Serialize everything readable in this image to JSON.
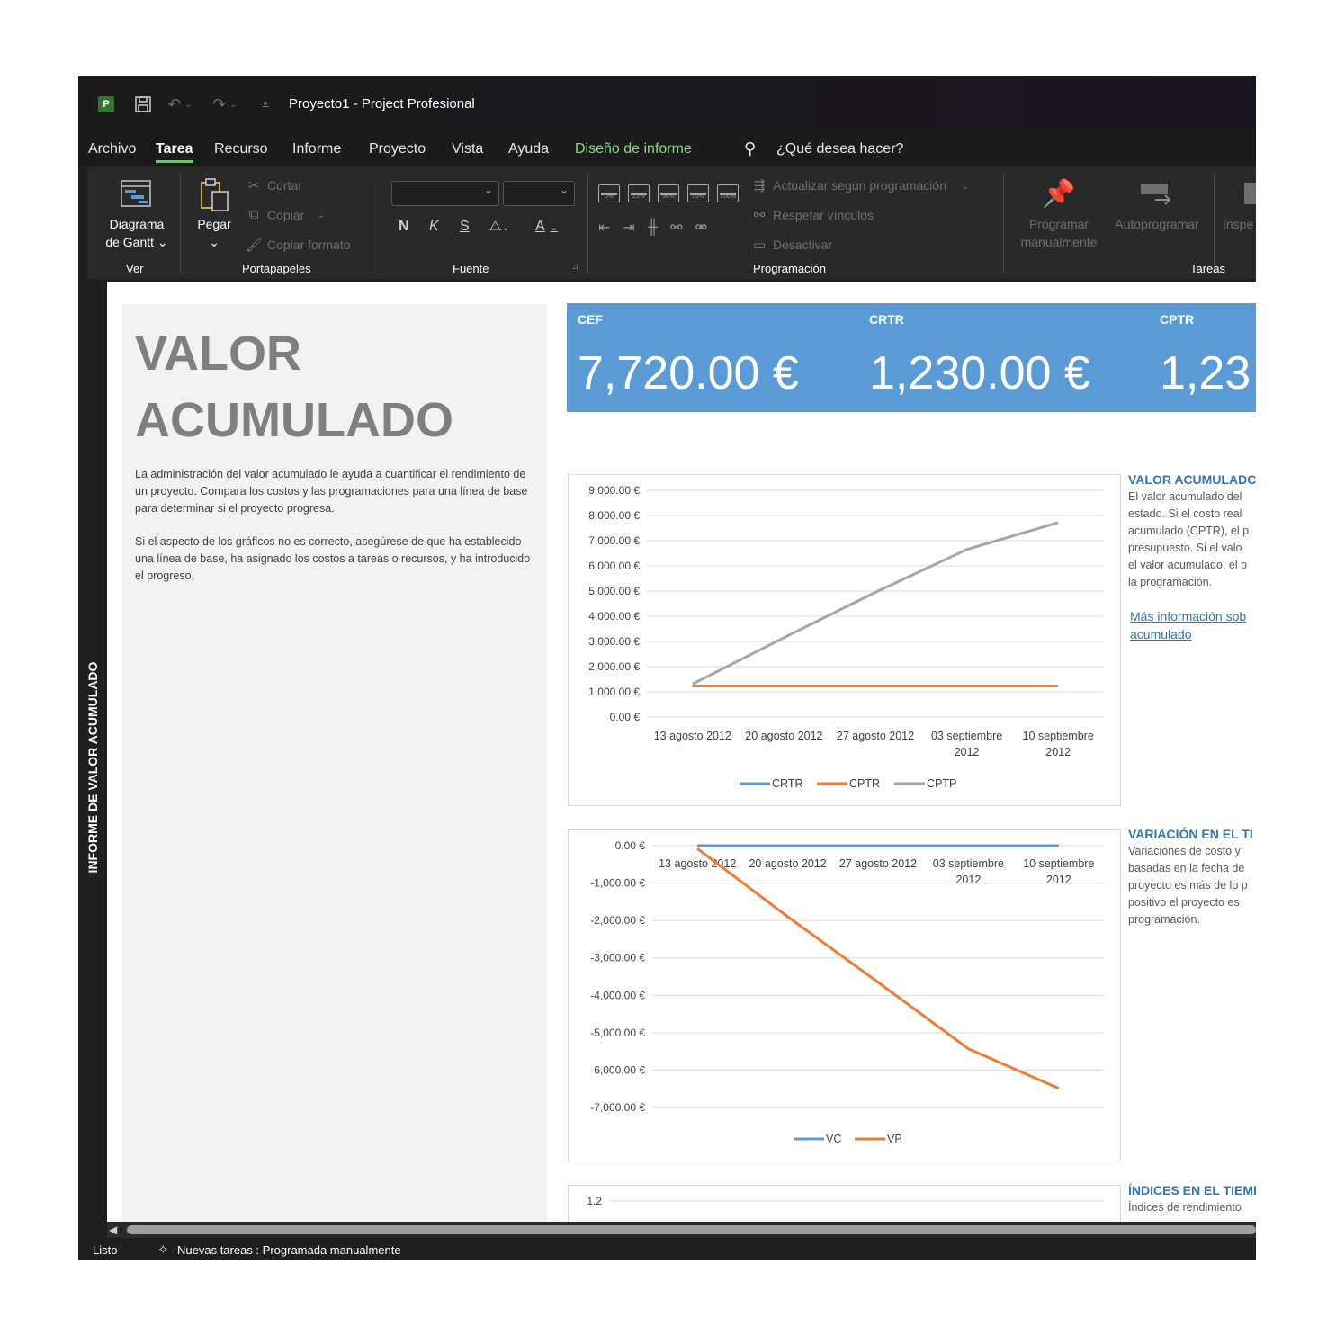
{
  "window": {
    "title": "Proyecto1  -  Project Profesional",
    "app_badge": "P"
  },
  "menu": {
    "tabs": [
      "Archivo",
      "Tarea",
      "Recurso",
      "Informe",
      "Proyecto",
      "Vista",
      "Ayuda",
      "Diseño de informe"
    ],
    "active": "Tarea",
    "search_placeholder": "¿Qué desea hacer?"
  },
  "ribbon": {
    "groups": {
      "ver": "Ver",
      "portapapeles": "Portapapeles",
      "fuente": "Fuente",
      "programacion": "Programación",
      "tareas": "Tareas"
    },
    "gantt": {
      "line1": "Diagrama",
      "line2": "de Gantt ⌄"
    },
    "paste": {
      "label": "Pegar",
      "arrow": "⌄"
    },
    "clipboard": {
      "cut": "Cortar",
      "copy": "Copiar",
      "copy_arrow": "⌄",
      "format_painter": "Copiar formato"
    },
    "font": {
      "bold": "N",
      "italic": "K",
      "underline": "S"
    },
    "percent_buttons": [
      "0%",
      "25%",
      "50%",
      "75%",
      "100%"
    ],
    "scheduling": {
      "update": "Actualizar según programación",
      "update_arrow": "⌄",
      "respect_links": "Respetar vínculos",
      "deactivate": "Desactivar"
    },
    "tasks": {
      "manual_line1": "Programar",
      "manual_line2": "manualmente",
      "auto": "Autoprogramar",
      "inspect": "Inspe"
    }
  },
  "side_label": "INFORME DE VALOR ACUMULADO",
  "report": {
    "title_line1": "VALOR",
    "title_line2": "ACUMULADO",
    "paragraph1": "La administración del valor acumulado le ayuda a cuantificar el rendimiento de un proyecto. Compara los costos y las programaciones para una línea de base para determinar si el proyecto progresa.",
    "paragraph2": "Si el aspecto de los gráficos no es correcto, asegúrese de que ha establecido una línea de base, ha asignado los costos a tareas o recursos, y ha introducido el progreso."
  },
  "kpis": [
    {
      "label": "CEF",
      "value": "7,720.00 €"
    },
    {
      "label": "CRTR",
      "value": "1,230.00 €"
    },
    {
      "label": "CPTR",
      "value": "1,23"
    }
  ],
  "side_panels": {
    "valor": {
      "title": "VALOR ACUMULADC",
      "lines": [
        "El valor acumulado del",
        "estado.  Si el costo real",
        "acumulado (CPTR), el p",
        "presupuesto.  Si el valo",
        "el valor acumulado, el p",
        "la programación."
      ],
      "link_line1": "Más información sob",
      "link_line2": "acumulado"
    },
    "variacion": {
      "title": "VARIACIÓN EN EL TI",
      "lines": [
        "Variaciones de costo y",
        "basadas en la fecha de",
        "proyecto es más de lo p",
        "positivo el proyecto es",
        "programación."
      ]
    },
    "indices": {
      "title": "ÍNDICES EN EL TIEMI",
      "lines": [
        "Índices de rendimiento"
      ]
    }
  },
  "chart_data": [
    {
      "type": "line",
      "categories": [
        "13 agosto 2012",
        "20 agosto 2012",
        "27 agosto 2012",
        "03 septiembre 2012",
        "10 septiembre 2012"
      ],
      "series": [
        {
          "name": "CRTR",
          "color": "#5b9bd5",
          "values": [
            null,
            null,
            null,
            null,
            null
          ]
        },
        {
          "name": "CPTR",
          "color": "#ed7d31",
          "values": [
            1230,
            1230,
            1230,
            1230,
            1230
          ]
        },
        {
          "name": "CPTP",
          "color": "#a5a5a5",
          "values": [
            1310,
            3150,
            4950,
            6650,
            7720
          ]
        }
      ],
      "y_ticks": [
        "9,000.00 €",
        "8,000.00 €",
        "7,000.00 €",
        "6,000.00 €",
        "5,000.00 €",
        "4,000.00 €",
        "3,000.00 €",
        "2,000.00 €",
        "1,000.00 €",
        "0.00 €"
      ],
      "ylim": [
        0,
        9000
      ],
      "grid": true,
      "legend": "bottom"
    },
    {
      "type": "line",
      "categories": [
        "13 agosto 2012",
        "20 agosto 2012",
        "27 agosto 2012",
        "03 septiembre 2012",
        "10 septiembre 2012"
      ],
      "series": [
        {
          "name": "VC",
          "color": "#5b9bd5",
          "values": [
            0,
            0,
            0,
            0,
            0
          ]
        },
        {
          "name": "VP",
          "color": "#ed7d31",
          "values": [
            -80,
            -1900,
            -3650,
            -5430,
            -6490
          ]
        }
      ],
      "y_ticks": [
        "0.00 €",
        "-1,000.00 €",
        "-2,000.00 €",
        "-3,000.00 €",
        "-4,000.00 €",
        "-5,000.00 €",
        "-6,000.00 €",
        "-7,000.00 €"
      ],
      "ylim": [
        -7000,
        0
      ],
      "grid": true,
      "legend": "bottom"
    },
    {
      "type": "line",
      "categories": [],
      "series": [],
      "y_ticks": [
        "1.2"
      ],
      "ylim": [
        0,
        1.2
      ],
      "grid": true
    }
  ],
  "status": {
    "ready": "Listo",
    "new_tasks": "Nuevas tareas : Programada manualmente"
  },
  "colors": {
    "accent_green": "#6fc26c",
    "kpi_blue": "#5b9bd5",
    "series_orange": "#ed7d31",
    "series_gray": "#a5a5a5",
    "title_gray": "#7f7f7f",
    "link_blue": "#2e75b6"
  }
}
